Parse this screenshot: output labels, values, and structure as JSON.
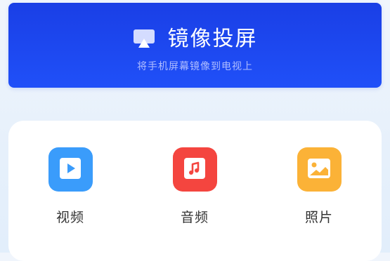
{
  "mirror": {
    "title": "镜像投屏",
    "subtitle": "将手机屏幕镜像到电视上",
    "icon": "airplay-screen-icon",
    "color": "#1f47f2"
  },
  "media": {
    "items": [
      {
        "label": "视频",
        "icon": "play-video-icon",
        "color": "#3a9cfb"
      },
      {
        "label": "音频",
        "icon": "music-note-icon",
        "color": "#f4453f"
      },
      {
        "label": "照片",
        "icon": "photo-image-icon",
        "color": "#fbb237"
      }
    ]
  }
}
